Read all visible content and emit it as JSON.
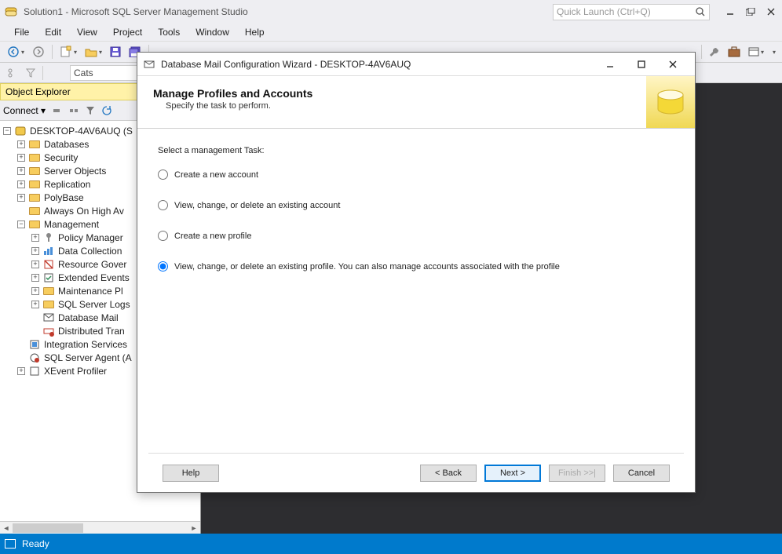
{
  "app": {
    "title": "Solution1 - Microsoft SQL Server Management Studio",
    "quick_launch_placeholder": "Quick Launch (Ctrl+Q)"
  },
  "menu": [
    "File",
    "Edit",
    "View",
    "Project",
    "Tools",
    "Window",
    "Help"
  ],
  "toolbar2": {
    "db_select": "Cats"
  },
  "object_explorer": {
    "title": "Object Explorer",
    "connect_label": "Connect",
    "server": "DESKTOP-4AV6AUQ (S",
    "nodes": {
      "databases": "Databases",
      "security": "Security",
      "server_objects": "Server Objects",
      "replication": "Replication",
      "polybase": "PolyBase",
      "always_on": "Always On High Av",
      "management": "Management",
      "policy_management": "Policy Manager",
      "data_collection": "Data Collection",
      "resource_governor": "Resource Gover",
      "extended_events": "Extended Events",
      "maintenance_plans": "Maintenance Pl",
      "sql_server_logs": "SQL Server Logs",
      "database_mail": "Database Mail",
      "distributed_tran": "Distributed Tran",
      "integration_services": "Integration Services",
      "sql_server_agent": "SQL Server Agent (A",
      "xevent_profiler": "XEvent Profiler"
    }
  },
  "status": {
    "text": "Ready"
  },
  "dialog": {
    "title": "Database Mail Configuration Wizard - DESKTOP-4AV6AUQ",
    "header_title": "Manage Profiles and Accounts",
    "header_subtitle": "Specify the task to perform.",
    "body_label": "Select a management Task:",
    "options": {
      "create_account": "Create a new account",
      "view_account": "View, change, or delete an existing account",
      "create_profile": "Create a new profile",
      "view_profile": "View, change, or delete an existing profile. You can also manage accounts associated with the profile"
    },
    "buttons": {
      "help": "Help",
      "back": "< Back",
      "next": "Next >",
      "finish": "Finish >>|",
      "cancel": "Cancel"
    }
  }
}
